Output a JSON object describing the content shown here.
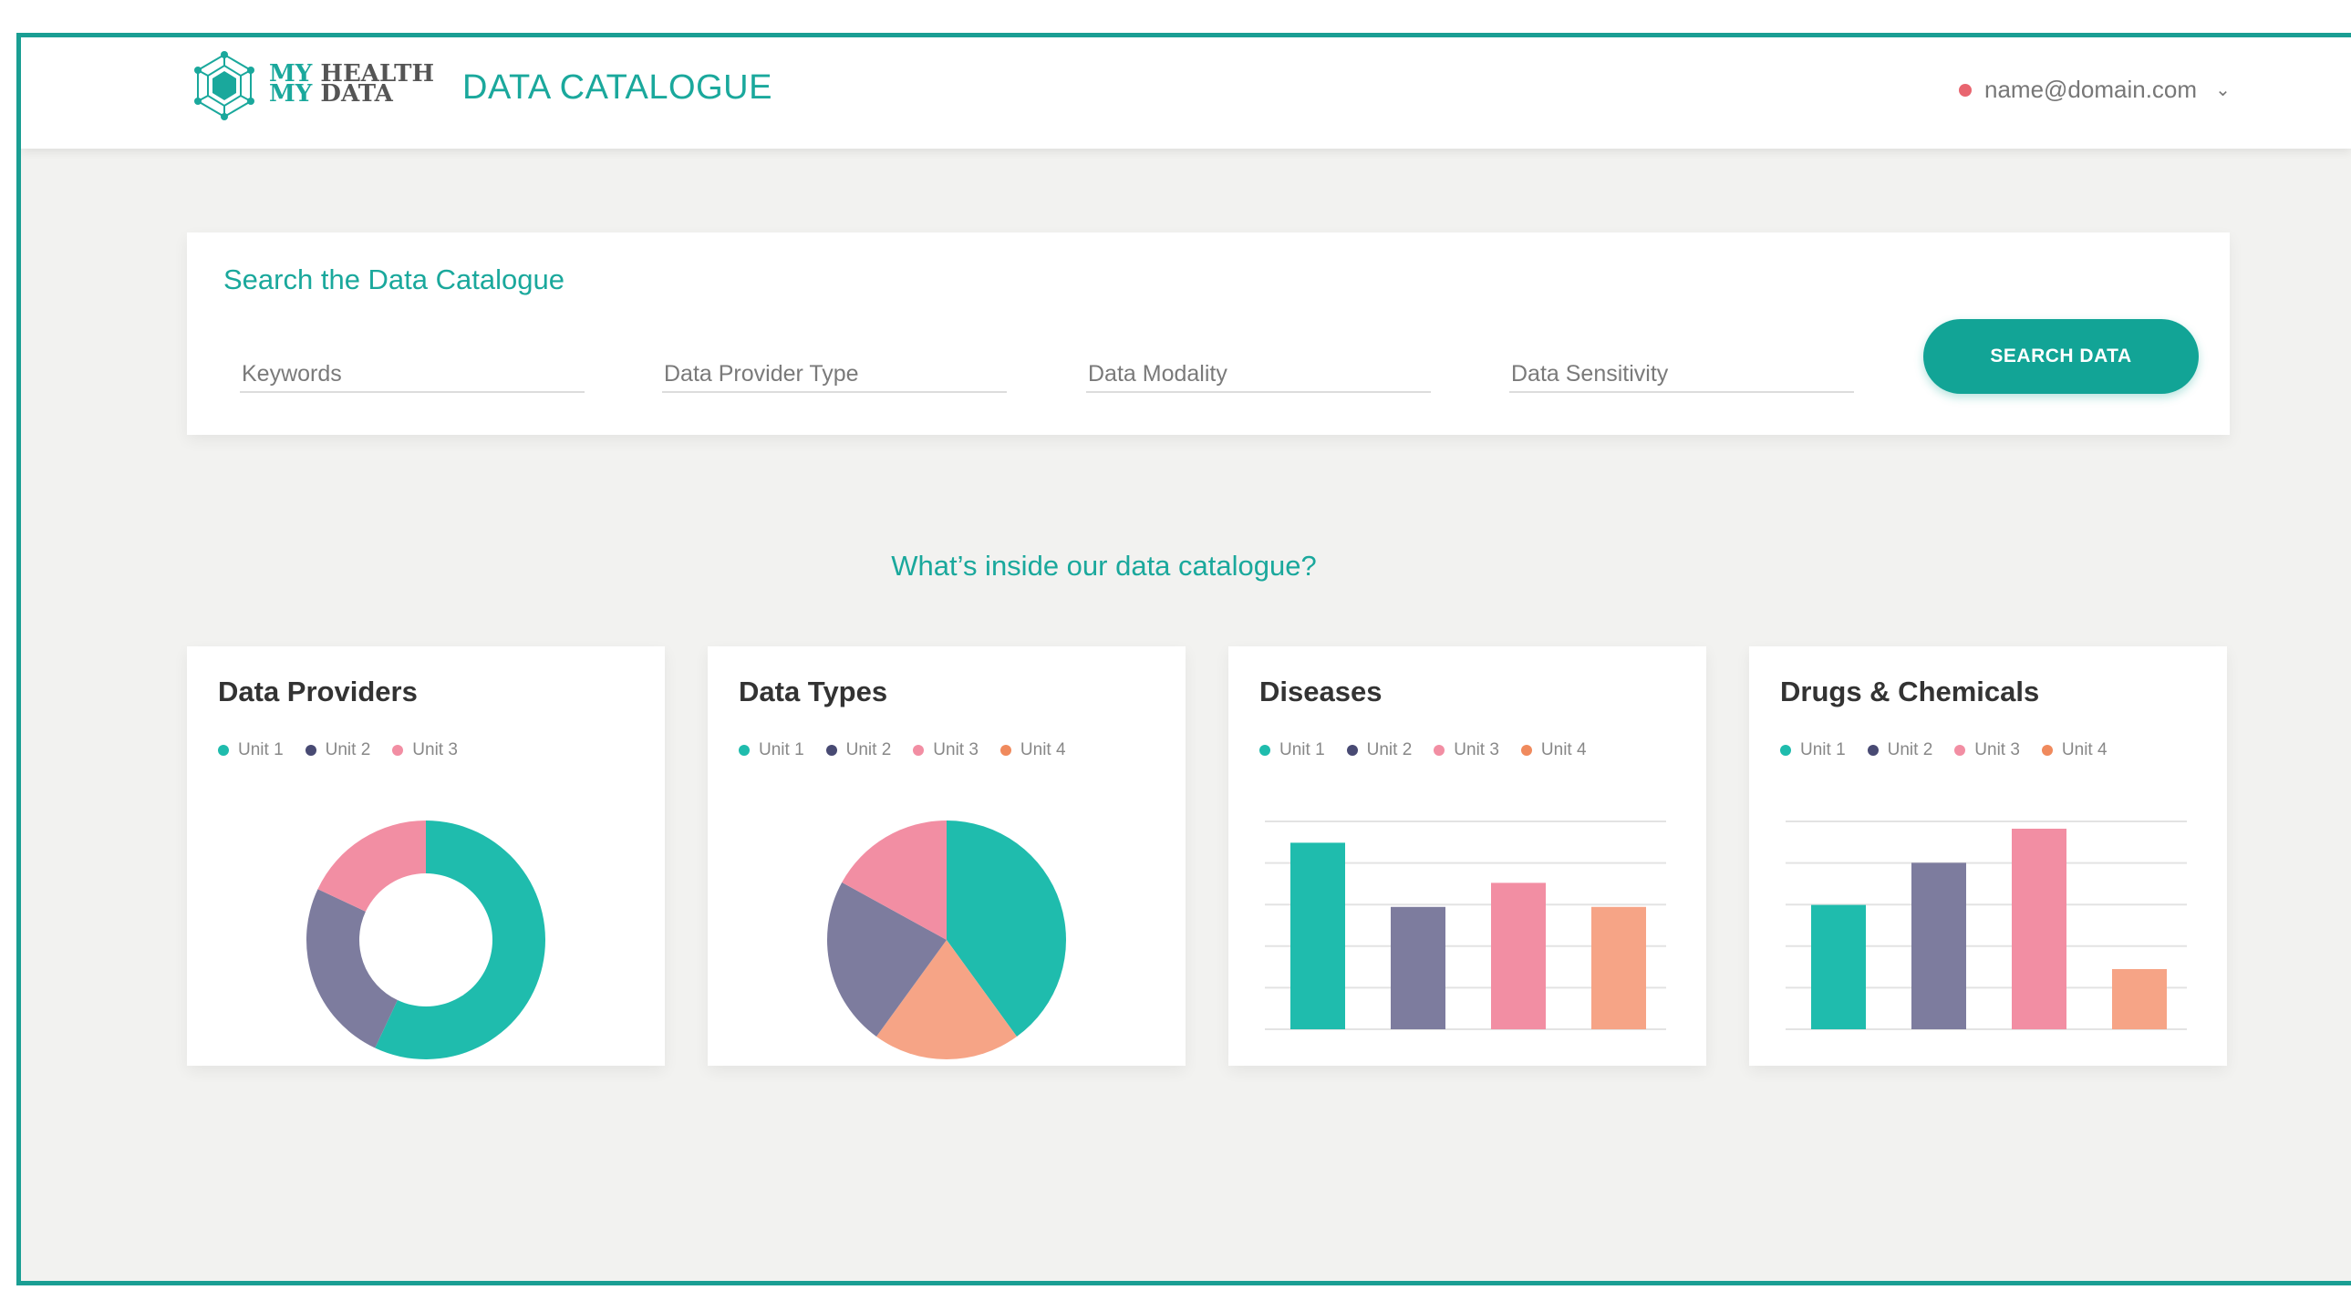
{
  "header": {
    "logo_line1": "MY HEALTH",
    "logo_line2": "MY DATA",
    "logo_my": "MY",
    "logo_health": "HEALTH",
    "logo_data": "DATA",
    "app_title": "DATA CATALOGUE",
    "user_email": "name@domain.com",
    "user_status_color": "#e8656f"
  },
  "search": {
    "title": "Search the Data Catalogue",
    "fields": [
      {
        "placeholder": "Keywords"
      },
      {
        "placeholder": "Data Provider Type"
      },
      {
        "placeholder": "Data Modality"
      },
      {
        "placeholder": "Data Sensitivity"
      }
    ],
    "button_label": "SEARCH DATA"
  },
  "section_heading": "What’s inside our data catalogue?",
  "colors": {
    "accent": "#1aa89c",
    "unit1": "#1fbcad",
    "unit2": "#7d7c9e",
    "unit3": "#f28ea3",
    "unit4": "#f6a486",
    "legend_unit2": "#484a73",
    "legend_unit4": "#f08a5d"
  },
  "cards": [
    {
      "title": "Data Providers",
      "legend": [
        "Unit 1",
        "Unit 2",
        "Unit 3"
      ]
    },
    {
      "title": "Data Types",
      "legend": [
        "Unit 1",
        "Unit 2",
        "Unit 3",
        "Unit 4"
      ]
    },
    {
      "title": "Diseases",
      "legend": [
        "Unit 1",
        "Unit 2",
        "Unit 3",
        "Unit 4"
      ]
    },
    {
      "title": "Drugs & Chemicals",
      "legend": [
        "Unit 1",
        "Unit 2",
        "Unit 3",
        "Unit 4"
      ]
    }
  ],
  "chart_data": [
    {
      "type": "pie",
      "variant": "donut",
      "title": "Data Providers",
      "categories": [
        "Unit 1",
        "Unit 2",
        "Unit 3"
      ],
      "values": [
        57,
        25,
        18
      ]
    },
    {
      "type": "pie",
      "title": "Data Types",
      "categories": [
        "Unit 1",
        "Unit 2",
        "Unit 3",
        "Unit 4"
      ],
      "values": [
        40,
        23,
        17,
        20
      ],
      "slice_order": [
        "Unit 1",
        "Unit 4",
        "Unit 2",
        "Unit 3"
      ]
    },
    {
      "type": "bar",
      "title": "Diseases",
      "categories": [
        "Unit 1",
        "Unit 2",
        "Unit 3",
        "Unit 4"
      ],
      "values": [
        93,
        61,
        73,
        61
      ],
      "ylim": [
        0,
        100
      ],
      "grid": true
    },
    {
      "type": "bar",
      "title": "Drugs & Chemicals",
      "categories": [
        "Unit 1",
        "Unit 2",
        "Unit 3",
        "Unit 4"
      ],
      "values": [
        62,
        83,
        100,
        30
      ],
      "ylim": [
        0,
        100
      ],
      "grid": true
    }
  ]
}
